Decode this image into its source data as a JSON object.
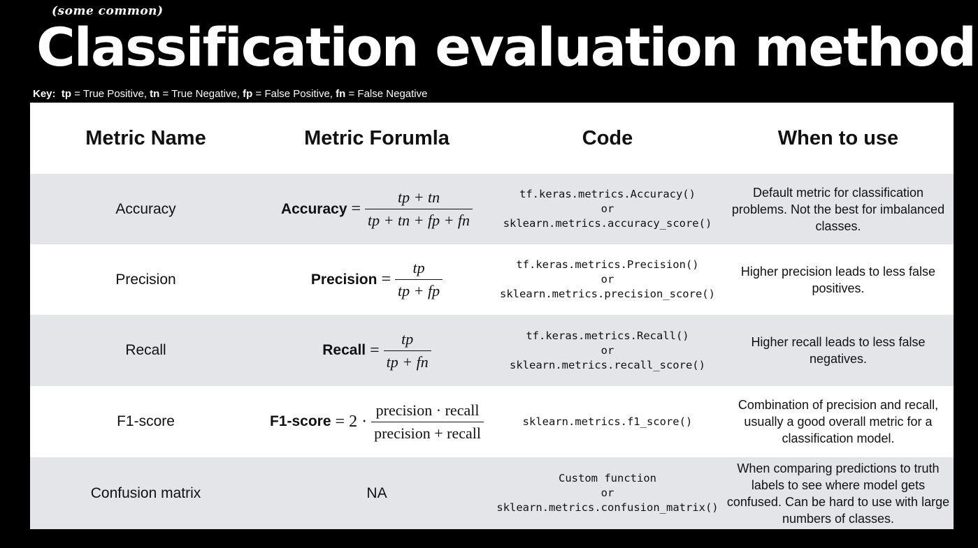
{
  "header": {
    "subtitle": "(some common)",
    "title": "Classification evaluation methods",
    "key": {
      "label": "Key:",
      "items": [
        {
          "abbr": "tp",
          "text": " = True Positive, "
        },
        {
          "abbr": "tn",
          "text": " = True Negative, "
        },
        {
          "abbr": "fp",
          "text": " = False Positive, "
        },
        {
          "abbr": "fn",
          "text": " = False Negative"
        }
      ]
    }
  },
  "table": {
    "columns": [
      "Metric Name",
      "Metric Forumla",
      "Code",
      "When to use"
    ],
    "rows": [
      {
        "name": "Accuracy",
        "formula": {
          "label": "Accuracy",
          "eq": "=",
          "prefix": "",
          "numerator": "tp + tn",
          "denominator": "tp + tn + fp + fn"
        },
        "code": [
          "tf.keras.metrics.Accuracy()",
          "or",
          "sklearn.metrics.accuracy_score()"
        ],
        "when": "Default metric for classification problems. Not the best for imbalanced classes."
      },
      {
        "name": "Precision",
        "formula": {
          "label": "Precision",
          "eq": "=",
          "prefix": "",
          "numerator": "tp",
          "denominator": "tp + fp"
        },
        "code": [
          "tf.keras.metrics.Precision()",
          "or",
          "sklearn.metrics.precision_score()"
        ],
        "when": "Higher precision leads to less false positives."
      },
      {
        "name": "Recall",
        "formula": {
          "label": "Recall",
          "eq": "=",
          "prefix": "",
          "numerator": "tp",
          "denominator": "tp + fn"
        },
        "code": [
          "tf.keras.metrics.Recall()",
          "or",
          "sklearn.metrics.recall_score()"
        ],
        "when": "Higher recall leads to less false negatives."
      },
      {
        "name": "F1-score",
        "formula": {
          "label": "F1-score",
          "eq": "=",
          "prefix": "2 ·",
          "numerator": "precision · recall",
          "denominator": "precision + recall"
        },
        "code": [
          "sklearn.metrics.f1_score()"
        ],
        "when": "Combination of precision and recall, usually a good overall metric for a classification model."
      },
      {
        "name": "Confusion matrix",
        "formula_text": "NA",
        "code": [
          "Custom function",
          "or",
          "sklearn.metrics.confusion_matrix()"
        ],
        "when": "When comparing predictions to truth labels to see where model gets confused. Can be hard to use with large numbers of classes."
      }
    ]
  },
  "colors": {
    "background": "#000000",
    "header_row": "#ffffff",
    "alt_row": "#e4e5e9",
    "text": "#111111"
  }
}
